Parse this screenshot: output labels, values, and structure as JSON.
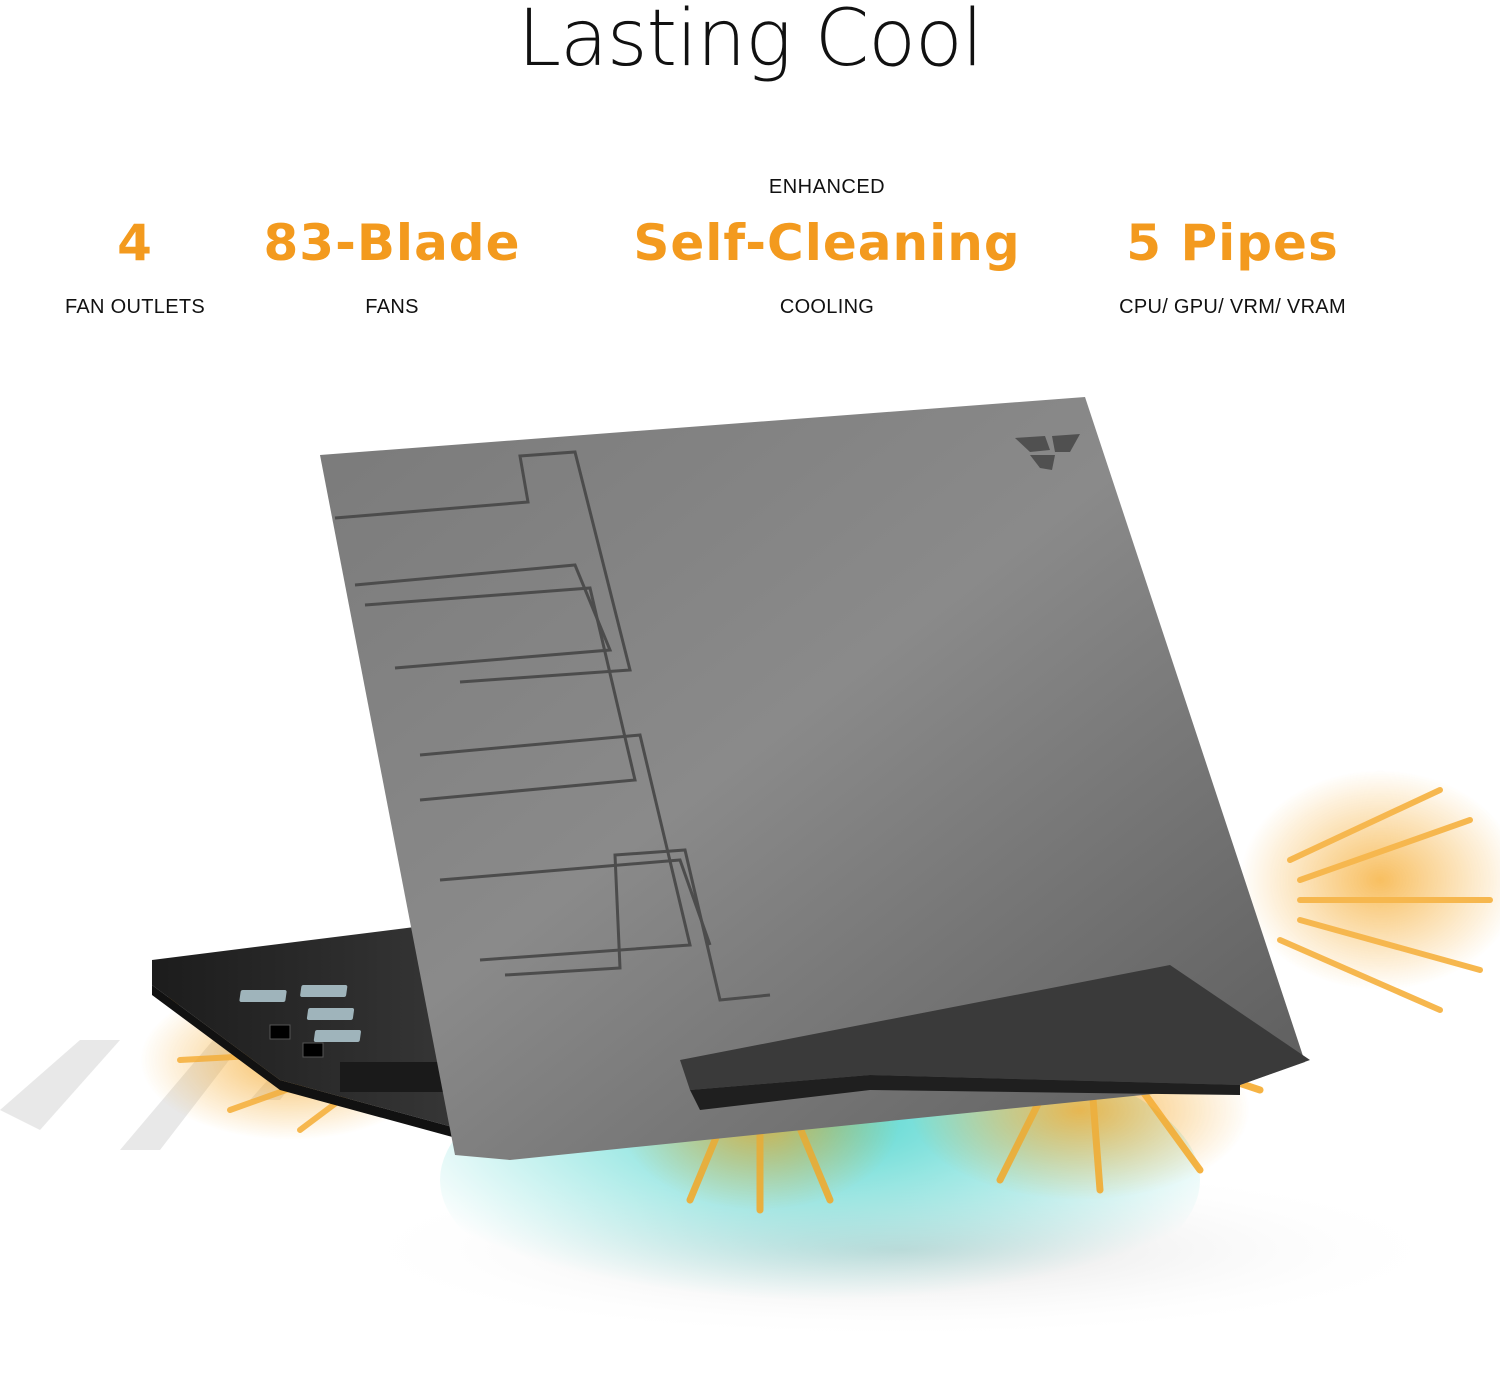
{
  "headline": "Lasting Cool",
  "features": [
    {
      "pre": "",
      "value": "4",
      "label": "FAN OUTLETS"
    },
    {
      "pre": "",
      "value": "83-Blade",
      "label": "FANS"
    },
    {
      "pre": "ENHANCED",
      "value": "Self-Cleaning",
      "label": "COOLING"
    },
    {
      "pre": "",
      "value": "5 Pipes",
      "label": "CPU/ GPU/ VRM/ VRAM"
    }
  ],
  "colors": {
    "accent": "#F39A1E",
    "heat": "#F5A623",
    "cool_air": "#39D0C8",
    "lid": "#6b6b6b",
    "base": "#2b2b2b"
  }
}
